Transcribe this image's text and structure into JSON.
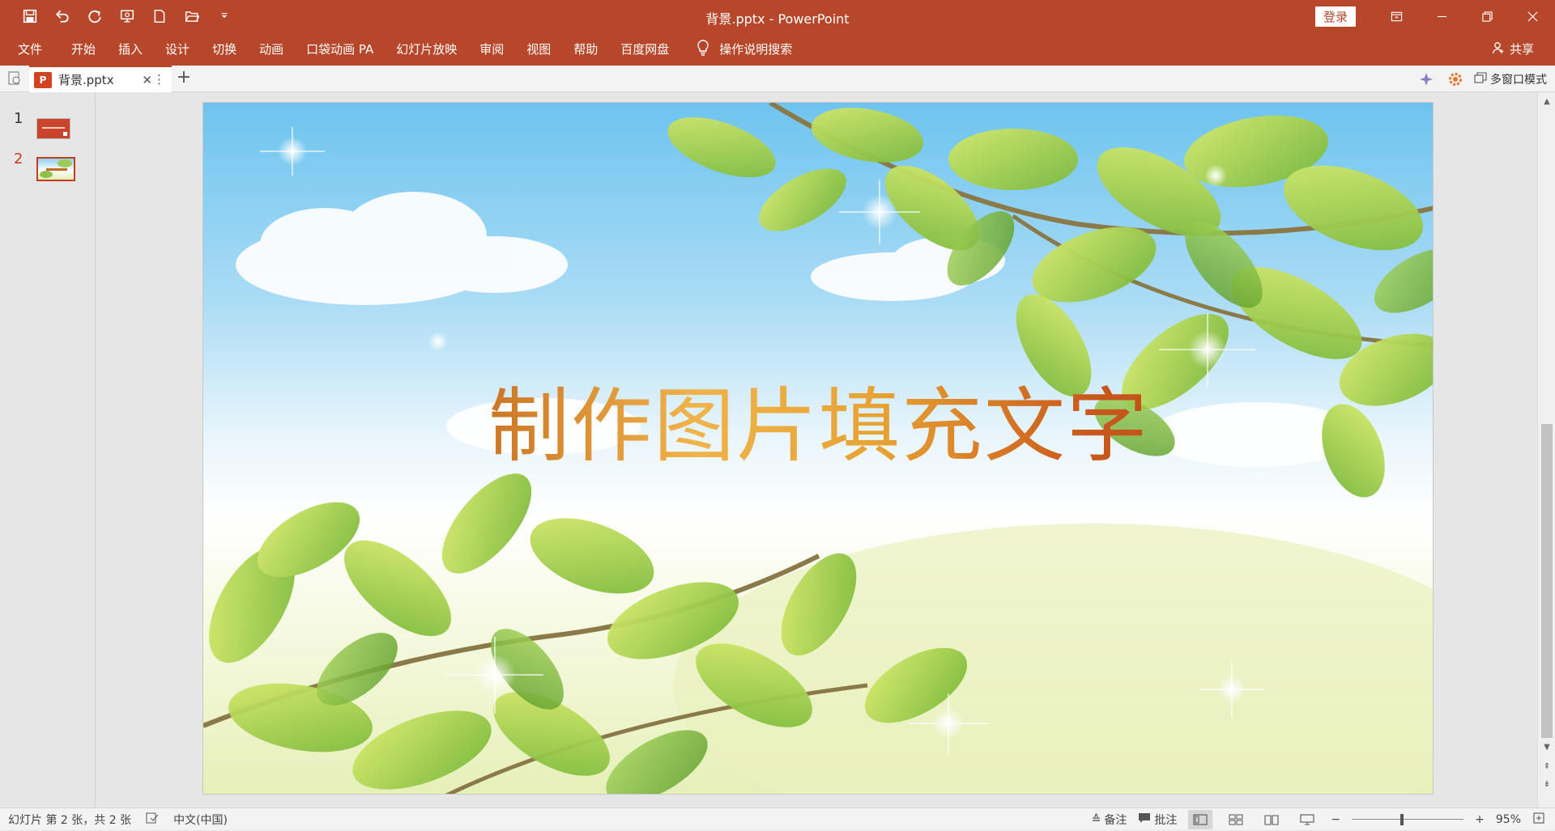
{
  "window": {
    "title": "背景.pptx  -  PowerPoint",
    "login_label": "登录"
  },
  "quick_access": {
    "icons": [
      "save-icon",
      "undo-icon",
      "redo-icon",
      "present-icon",
      "new-icon",
      "open-icon",
      "customize-icon"
    ]
  },
  "ribbon": {
    "tabs": [
      "文件",
      "开始",
      "插入",
      "设计",
      "切换",
      "动画",
      "口袋动画 PA",
      "幻灯片放映",
      "审阅",
      "视图",
      "帮助",
      "百度网盘"
    ],
    "search_label": "操作说明搜索",
    "share_label": "共享"
  },
  "docbar": {
    "tab_label": "背景.pptx",
    "tab_icon_letter": "P",
    "multiwindow_label": "多窗口模式"
  },
  "thumbnails": [
    {
      "number": "1",
      "active": false
    },
    {
      "number": "2",
      "active": true
    }
  ],
  "slide": {
    "title": "制作图片填充文字"
  },
  "status": {
    "slide_info": "幻灯片 第 2 张，共 2 张",
    "language": "中文(中国)",
    "notes_label": "备注",
    "comments_label": "批注",
    "zoom_minus": "−",
    "zoom_plus": "+",
    "zoom_level": "95%",
    "zoom_fraction": 0.45
  },
  "colors": {
    "accent": "#b7472a",
    "active_thumb": "#c43e1c"
  }
}
